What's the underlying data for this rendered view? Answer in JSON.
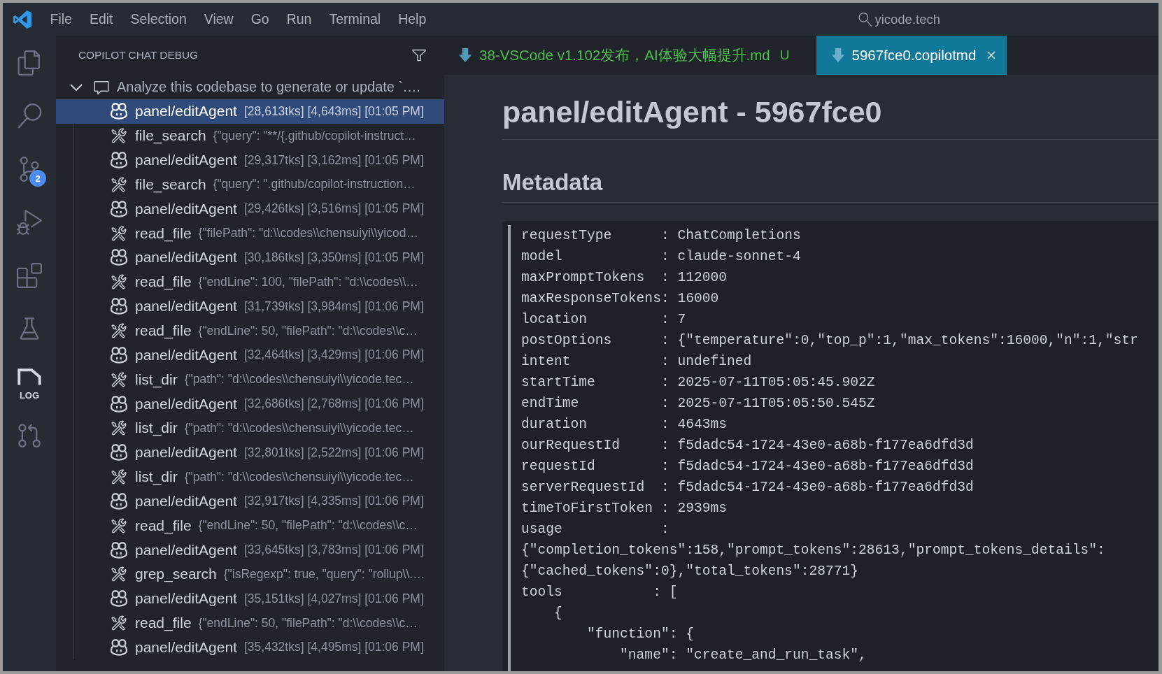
{
  "title_bar": {
    "menu": [
      "File",
      "Edit",
      "Selection",
      "View",
      "Go",
      "Run",
      "Terminal",
      "Help"
    ],
    "search": "yicode.tech"
  },
  "activity_bar": [
    {
      "kind": "explorer",
      "selected": false
    },
    {
      "kind": "search",
      "selected": false
    },
    {
      "kind": "source_control",
      "selected": false,
      "badge": "2"
    },
    {
      "kind": "run_debug",
      "selected": false
    },
    {
      "kind": "extensions",
      "selected": false
    },
    {
      "kind": "testing",
      "selected": false
    },
    {
      "kind": "log",
      "selected": true,
      "label": "LOG"
    },
    {
      "kind": "pull_requests",
      "selected": false
    }
  ],
  "sidebar": {
    "title": "COPILOT CHAT DEBUG",
    "tree": {
      "label": "Analyze this codebase to generate or update `.…",
      "expanded": true,
      "children": [
        {
          "kind": "agent",
          "label": "panel/editAgent",
          "details": "[28,613tks] [4,643ms] [01:05 PM]",
          "selected": true
        },
        {
          "kind": "tool",
          "label": "file_search",
          "details": "{\"query\": \"**/{.github/copilot-instruct…",
          "selected": false
        },
        {
          "kind": "agent",
          "label": "panel/editAgent",
          "details": "[29,317tks] [3,162ms] [01:05 PM]",
          "selected": false
        },
        {
          "kind": "tool",
          "label": "file_search",
          "details": "{\"query\": \".github/copilot-instruction…",
          "selected": false
        },
        {
          "kind": "agent",
          "label": "panel/editAgent",
          "details": "[29,426tks] [3,516ms] [01:05 PM]",
          "selected": false
        },
        {
          "kind": "tool",
          "label": "read_file",
          "details": "{\"filePath\": \"d:\\\\codes\\\\chensuiyi\\\\yicod…",
          "selected": false
        },
        {
          "kind": "agent",
          "label": "panel/editAgent",
          "details": "[30,186tks] [3,350ms] [01:05 PM]",
          "selected": false
        },
        {
          "kind": "tool",
          "label": "read_file",
          "details": "{\"endLine\": 100, \"filePath\": \"d:\\\\codes\\\\…",
          "selected": false
        },
        {
          "kind": "agent",
          "label": "panel/editAgent",
          "details": "[31,739tks] [3,984ms] [01:06 PM]",
          "selected": false
        },
        {
          "kind": "tool",
          "label": "read_file",
          "details": "{\"endLine\": 50, \"filePath\": \"d:\\\\codes\\\\c…",
          "selected": false
        },
        {
          "kind": "agent",
          "label": "panel/editAgent",
          "details": "[32,464tks] [3,429ms] [01:06 PM]",
          "selected": false
        },
        {
          "kind": "tool",
          "label": "list_dir",
          "details": "{\"path\": \"d:\\\\codes\\\\chensuiyi\\\\yicode.tec…",
          "selected": false
        },
        {
          "kind": "agent",
          "label": "panel/editAgent",
          "details": "[32,686tks] [2,768ms] [01:06 PM]",
          "selected": false
        },
        {
          "kind": "tool",
          "label": "list_dir",
          "details": "{\"path\": \"d:\\\\codes\\\\chensuiyi\\\\yicode.tec…",
          "selected": false
        },
        {
          "kind": "agent",
          "label": "panel/editAgent",
          "details": "[32,801tks] [2,522ms] [01:06 PM]",
          "selected": false
        },
        {
          "kind": "tool",
          "label": "list_dir",
          "details": "{\"path\": \"d:\\\\codes\\\\chensuiyi\\\\yicode.tec…",
          "selected": false
        },
        {
          "kind": "agent",
          "label": "panel/editAgent",
          "details": "[32,917tks] [4,335ms] [01:06 PM]",
          "selected": false
        },
        {
          "kind": "tool",
          "label": "read_file",
          "details": "{\"endLine\": 50, \"filePath\": \"d:\\\\codes\\\\c…",
          "selected": false
        },
        {
          "kind": "agent",
          "label": "panel/editAgent",
          "details": "[33,645tks] [3,783ms] [01:06 PM]",
          "selected": false
        },
        {
          "kind": "tool",
          "label": "grep_search",
          "details": "{\"isRegexp\": true, \"query\": \"rollup\\\\.…",
          "selected": false
        },
        {
          "kind": "agent",
          "label": "panel/editAgent",
          "details": "[35,151tks] [4,027ms] [01:06 PM]",
          "selected": false
        },
        {
          "kind": "tool",
          "label": "read_file",
          "details": "{\"endLine\": 50, \"filePath\": \"d:\\\\codes\\\\c…",
          "selected": false
        },
        {
          "kind": "agent",
          "label": "panel/editAgent",
          "details": "[35,432tks] [4,495ms] [01:06 PM]",
          "selected": false
        }
      ]
    }
  },
  "tabs": [
    {
      "label": "38-VSCode v1.102发布，AI体验大幅提升.md",
      "decoration": "U",
      "selected": false
    },
    {
      "label": "5967fce0.copilotmd",
      "selected": true
    }
  ],
  "editor": {
    "title": "panel/editAgent - 5967fce0",
    "section": "Metadata",
    "code_lines": [
      "requestType      : ChatCompletions",
      "model            : claude-sonnet-4",
      "maxPromptTokens  : 112000",
      "maxResponseTokens: 16000",
      "location         : 7",
      "postOptions      : {\"temperature\":0,\"top_p\":1,\"max_tokens\":16000,\"n\":1,\"str",
      "intent           : undefined",
      "startTime        : 2025-07-11T05:05:45.902Z",
      "endTime          : 2025-07-11T05:05:50.545Z",
      "duration         : 4643ms",
      "ourRequestId     : f5dadc54-1724-43e0-a68b-f177ea6dfd3d",
      "requestId        : f5dadc54-1724-43e0-a68b-f177ea6dfd3d",
      "serverRequestId  : f5dadc54-1724-43e0-a68b-f177ea6dfd3d",
      "timeToFirstToken : 2939ms",
      "usage            :",
      "{\"completion_tokens\":158,\"prompt_tokens\":28613,\"prompt_tokens_details\":",
      "{\"cached_tokens\":0},\"total_tokens\":28771}",
      "tools           : [",
      "    {",
      "        \"function\": {",
      "            \"name\": \"create_and_run_task\","
    ]
  }
}
